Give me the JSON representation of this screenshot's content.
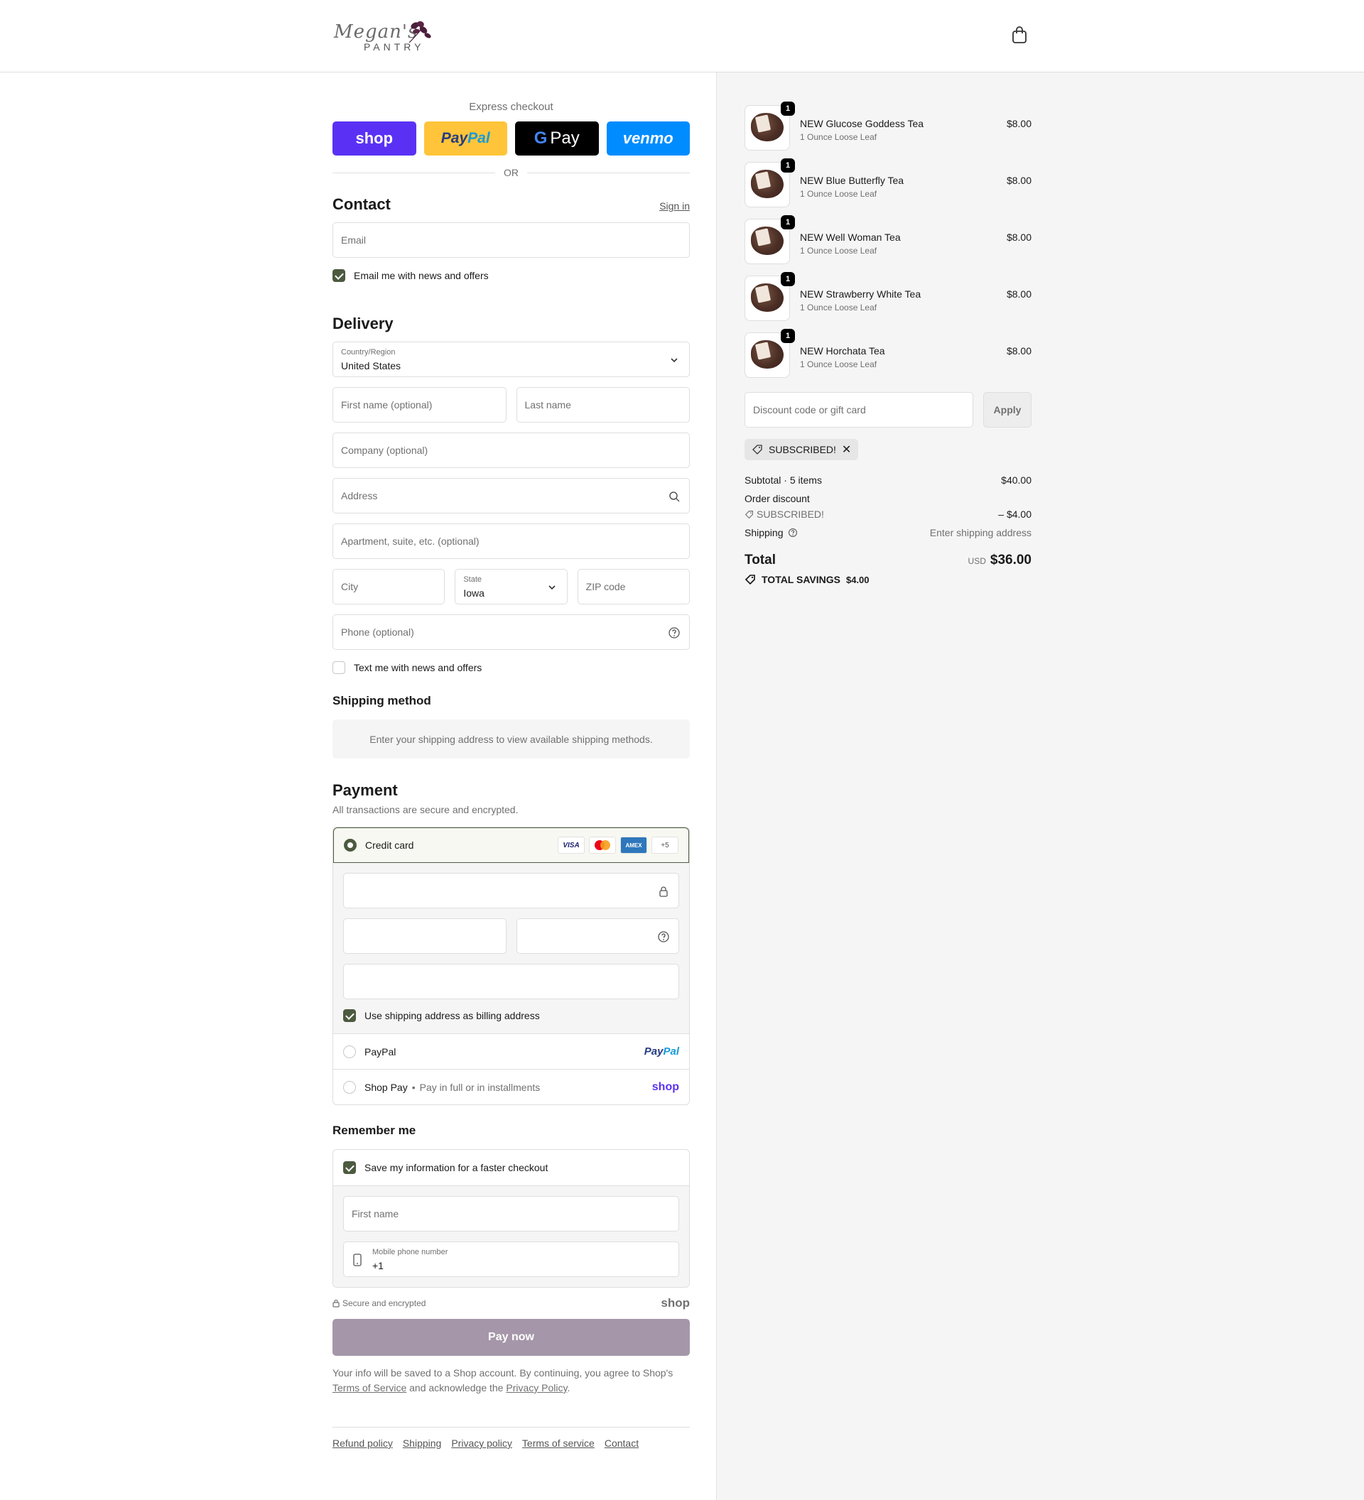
{
  "header": {
    "logo_script": "Megan's",
    "logo_pantry": "PANTRY"
  },
  "express": {
    "title": "Express checkout",
    "shop": "shop",
    "paypal_1": "Pay",
    "paypal_2": "Pal",
    "gpay_g": "G",
    "gpay": "Pay",
    "venmo": "venmo",
    "or": "OR"
  },
  "contact": {
    "title": "Contact",
    "sign_in": "Sign in",
    "email_placeholder": "Email",
    "news_label": "Email me with news and offers"
  },
  "delivery": {
    "title": "Delivery",
    "country_label": "Country/Region",
    "country_value": "United States",
    "first_name": "First name (optional)",
    "last_name": "Last name",
    "company": "Company (optional)",
    "address": "Address",
    "apartment": "Apartment, suite, etc. (optional)",
    "city": "City",
    "state_label": "State",
    "state_value": "Iowa",
    "zip": "ZIP code",
    "phone": "Phone (optional)",
    "text_label": "Text me with news and offers"
  },
  "shipping_method": {
    "title": "Shipping method",
    "notice": "Enter your shipping address to view available shipping methods."
  },
  "payment": {
    "title": "Payment",
    "subtitle": "All transactions are secure and encrypted.",
    "credit_card": "Credit card",
    "visa": "VISA",
    "amex": "AMEX",
    "more": "+5",
    "billing_label": "Use shipping address as billing address",
    "paypal": "PayPal",
    "paypal_logo_1": "Pay",
    "paypal_logo_2": "Pal",
    "shop_pay": "Shop Pay",
    "shop_pay_sub": "Pay in full or in installments",
    "shop_logo": "shop"
  },
  "remember": {
    "title": "Remember me",
    "save_label": "Save my information for a faster checkout",
    "first_name": "First name",
    "mobile_label": "Mobile phone number",
    "mobile_value": "+1",
    "secure": "Secure and encrypted",
    "shop_logo": "shop"
  },
  "pay_now": "Pay now",
  "legal": {
    "text1": "Your info will be saved to a Shop account. By continuing, you agree to Shop's",
    "terms": "Terms of Service",
    "text2": "and acknowledge the",
    "privacy": "Privacy Policy",
    "dot": "."
  },
  "footer": {
    "links": [
      "Refund policy",
      "Shipping",
      "Privacy policy",
      "Terms of service",
      "Contact"
    ]
  },
  "summary": {
    "items": [
      {
        "name": "NEW Glucose Goddess Tea",
        "variant": "1 Ounce Loose Leaf",
        "price": "$8.00",
        "qty": "1"
      },
      {
        "name": "NEW Blue Butterfly Tea",
        "variant": "1 Ounce Loose Leaf",
        "price": "$8.00",
        "qty": "1"
      },
      {
        "name": "NEW Well Woman Tea",
        "variant": "1 Ounce Loose Leaf",
        "price": "$8.00",
        "qty": "1"
      },
      {
        "name": "NEW Strawberry White Tea",
        "variant": "1 Ounce Loose Leaf",
        "price": "$8.00",
        "qty": "1"
      },
      {
        "name": "NEW Horchata Tea",
        "variant": "1 Ounce Loose Leaf",
        "price": "$8.00",
        "qty": "1"
      }
    ],
    "discount_placeholder": "Discount code or gift card",
    "apply": "Apply",
    "code": "SUBSCRIBED!",
    "subtotal_label": "Subtotal · 5 items",
    "subtotal": "$40.00",
    "order_discount": "Order discount",
    "discount_code": "SUBSCRIBED!",
    "discount_amount": "– $4.00",
    "shipping_label": "Shipping",
    "shipping_value": "Enter shipping address",
    "total_label": "Total",
    "currency": "USD",
    "total": "$36.00",
    "savings_label": "TOTAL SAVINGS",
    "savings": "$4.00"
  },
  "colors": {
    "accent": "#4c5a3f",
    "pay_button": "#a597a9",
    "shop_purple": "#5a31f4",
    "paypal_yellow": "#ffc439",
    "venmo_blue": "#008cff"
  }
}
